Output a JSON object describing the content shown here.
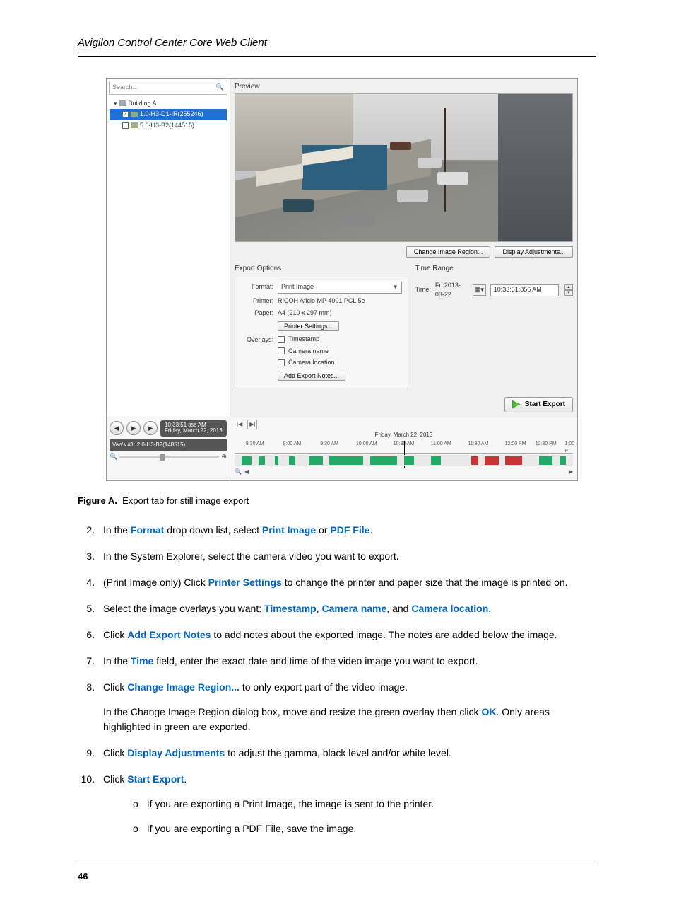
{
  "header": "Avigilon Control Center Core Web Client",
  "page_number": "46",
  "screenshot": {
    "search_placeholder": "Search...",
    "tree": {
      "root": "Building A",
      "cam1": "1.0-H3-D1-IR(255246)",
      "cam2": "5.0-H3-B2(144515)"
    },
    "preview_label": "Preview",
    "buttons": {
      "change_region": "Change Image Region...",
      "display_adj": "Display Adjustments...",
      "printer_settings": "Printer Settings...",
      "add_notes": "Add Export Notes...",
      "start_export": "Start Export"
    },
    "export_options": {
      "title": "Export Options",
      "format_label": "Format:",
      "format_value": "Print Image",
      "printer_label": "Printer:",
      "printer_value": "RICOH Aficio MP 4001 PCL 5e",
      "paper_label": "Paper:",
      "paper_value": "A4 (210 x 297 mm)",
      "overlays_label": "Overlays:",
      "overlay_ts": "Timestamp",
      "overlay_name": "Camera name",
      "overlay_loc": "Camera location"
    },
    "time_range": {
      "title": "Time Range",
      "time_label": "Time:",
      "date_value": "Fri 2013-03-22",
      "time_value": "10:33:51:856 AM"
    },
    "playback": {
      "time_main": "10:33:51",
      "time_unit": "856",
      "time_ampm": "AM",
      "date": "Friday, March 22, 2013",
      "cam_label": "Van's #1: 2.0-H3-B2(148515)"
    },
    "timeline": {
      "date_center": "Friday, March 22, 2013",
      "ticks": [
        "8:30 AM",
        "9:00 AM",
        "9:30 AM",
        "10:00 AM",
        "10:30 AM",
        "11:00 AM",
        "11:30 AM",
        "12:00 PM",
        "12:30 PM",
        "1:00 P"
      ]
    }
  },
  "caption_prefix": "Figure A.",
  "caption_text": "Export tab for still image export",
  "steps": {
    "s2_a": "In the ",
    "s2_format": "Format",
    "s2_b": " drop down list, select ",
    "s2_print": "Print Image",
    "s2_c": " or ",
    "s2_pdf": "PDF File",
    "s2_d": ".",
    "s3": "In the System Explorer, select the camera video you want to export.",
    "s4_a": "(Print Image only) Click ",
    "s4_ps": "Printer Settings",
    "s4_b": " to change the printer and paper size that the image is printed on.",
    "s5_a": "Select the image overlays you want: ",
    "s5_ts": "Timestamp",
    "s5_c1": ", ",
    "s5_cn": "Camera name",
    "s5_c2": ", and ",
    "s5_cl": "Camera location",
    "s5_d": ".",
    "s6_a": "Click ",
    "s6_notes": "Add Export Notes",
    "s6_b": " to add notes about the exported image. The notes are added below the image.",
    "s7_a": "In the ",
    "s7_time": "Time",
    "s7_b": " field, enter the exact date and time of the video image you want to export.",
    "s8_a": "Click ",
    "s8_cir": "Change Image Region...",
    "s8_b": " to only export part of the video image.",
    "s8_para_a": "In the Change Image Region dialog box, move and resize the green overlay then click ",
    "s8_ok": "OK",
    "s8_para_b": ". Only areas highlighted in green are exported.",
    "s9_a": "Click ",
    "s9_da": "Display Adjustments",
    "s9_b": " to adjust the gamma, black level and/or white level.",
    "s10_a": "Click ",
    "s10_se": "Start Export",
    "s10_b": ".",
    "s10_bul1": "If you are exporting a Print Image, the image is sent to the printer.",
    "s10_bul2": "If you are exporting a PDF File, save the image."
  }
}
